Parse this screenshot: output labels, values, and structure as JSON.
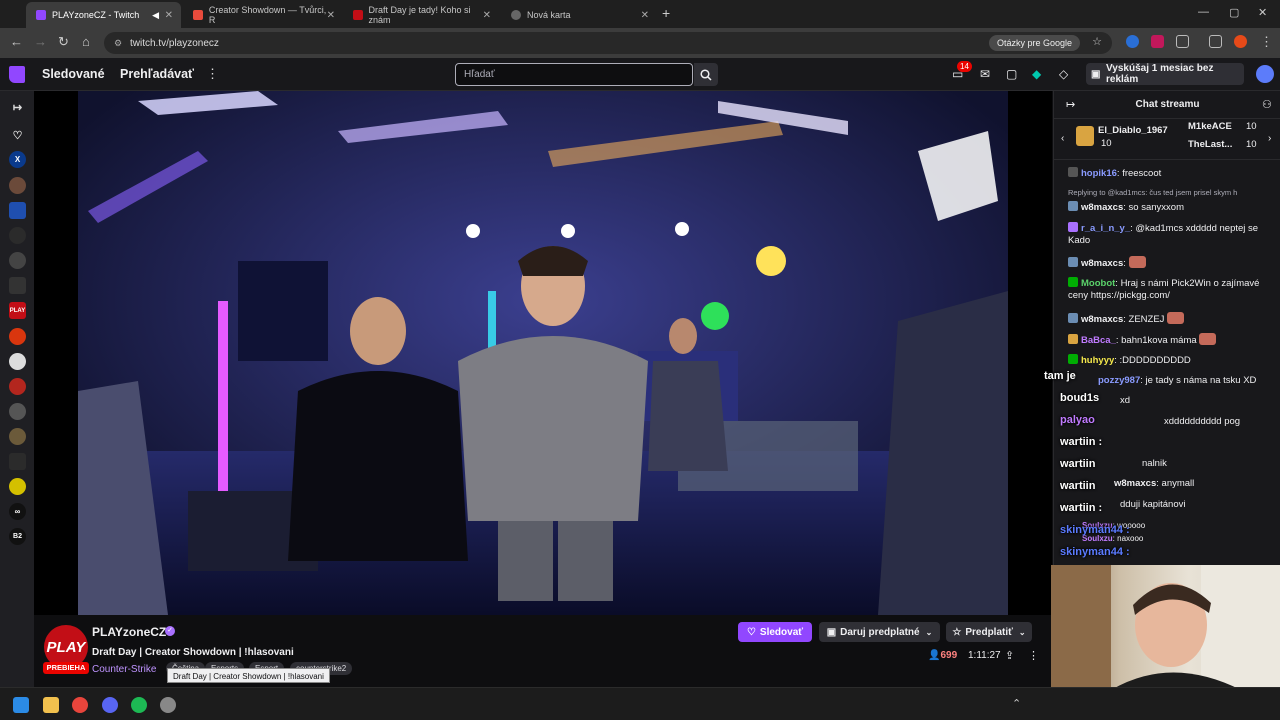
{
  "browser": {
    "tabs": [
      {
        "title": "PLAYzoneCZ - Twitch",
        "active": true
      },
      {
        "title": "Creator Showdown — Tvůrci, R",
        "active": false
      },
      {
        "title": "Draft Day je tady! Koho si znám",
        "active": false
      },
      {
        "title": "Nová karta",
        "active": false
      }
    ],
    "url": "twitch.tv/playzonecz",
    "google_questions": "Otázky pre Google"
  },
  "twitch_nav": {
    "following": "Sledované",
    "browse": "Prehľadávať",
    "search_placeholder": "Hľadať",
    "notifications_count": "14",
    "promo": "Vyskúšaj 1 mesiac bez reklám"
  },
  "sidebar": {
    "items": [
      "X",
      "PLAY",
      "∞",
      "B2"
    ]
  },
  "stream": {
    "channel_logo": "PLAY",
    "live_badge": "PREBIEHA",
    "channel_name": "PLAYzoneCZ",
    "title": "Draft Day | Creator Showdown | !hlasovani",
    "game": "Counter-Strike",
    "tags": [
      "Čeština",
      "Esports",
      "Esport",
      "counterstrike2"
    ],
    "tooltip": "Draft Day | Creator Showdown | !hlasovani",
    "follow_label": "Sledovať",
    "gift_label": "Daruj predplatné",
    "subscribe_label": "Predplatiť",
    "viewers": "699",
    "uptime": "1:11:27"
  },
  "chat": {
    "title": "Chat streamu",
    "gifters": [
      {
        "name": "El_Diablo_1967",
        "count": "10"
      },
      {
        "name": "M1keACE",
        "count": "10"
      },
      {
        "name": "TheLast...",
        "count": "10"
      }
    ],
    "messages": [
      {
        "user": "hopik16",
        "text": "freescoot",
        "color": "#8a9bff"
      },
      {
        "user": "",
        "text": "Replying to @kad1mcs: čus ted jsem prisel skym h",
        "color": "#adadb8"
      },
      {
        "user": "w8maxcs",
        "text": "so sanyxxom",
        "color": "#dedee3"
      },
      {
        "user": "r_a_i_n_y_",
        "text": "@kad1mcs xddddd neptej se Kado",
        "color": "#8a9bff"
      },
      {
        "user": "w8maxcs",
        "text": "",
        "color": "#dedee3"
      },
      {
        "user": "Moobot",
        "text": "Hraj s námi Pick2Win o zajímavé ceny https://pickgg.com/",
        "color": "#5bd36b"
      },
      {
        "user": "w8maxcs",
        "text": "ZENZEJ",
        "color": "#dedee3"
      },
      {
        "user": "BaBca_",
        "text": "bahn1kova máma",
        "color": "#c07bff"
      },
      {
        "user": "huhyyy",
        "text": ":DDDDDDDDDD",
        "color": "#f5e94b"
      },
      {
        "user": "pozzy987",
        "text": "je tady s náma na tsku XD",
        "color": "#8a9bff"
      },
      {
        "user": "",
        "text": "xd",
        "color": "#dedee3"
      },
      {
        "user": "",
        "text": "xdddddddddd pog",
        "color": "#dedee3"
      },
      {
        "user": "",
        "text": "",
        "color": "#dedee3"
      },
      {
        "user": "",
        "text": "nalnik",
        "color": "#dedee3"
      },
      {
        "user": "w8maxcs",
        "text": "anymall",
        "color": "#dedee3"
      },
      {
        "user": "",
        "text": "dduji kapitánovi",
        "color": "#dedee3"
      },
      {
        "user": "Soulxzu",
        "text": "wooooo",
        "color": "#c07bff"
      },
      {
        "user": "Soulxzu",
        "text": "naxooo",
        "color": "#c07bff"
      }
    ],
    "overlay_names": [
      "tam je",
      "boud1s",
      "palyao",
      "wartiin :",
      "wartiin",
      "wartiin",
      "wartiin :",
      "skinyman44 :",
      "skinyman44 :"
    ]
  },
  "colors": {
    "twitch_purple": "#9147ff",
    "live_red": "#eb0400",
    "background": "#0e0e10"
  }
}
